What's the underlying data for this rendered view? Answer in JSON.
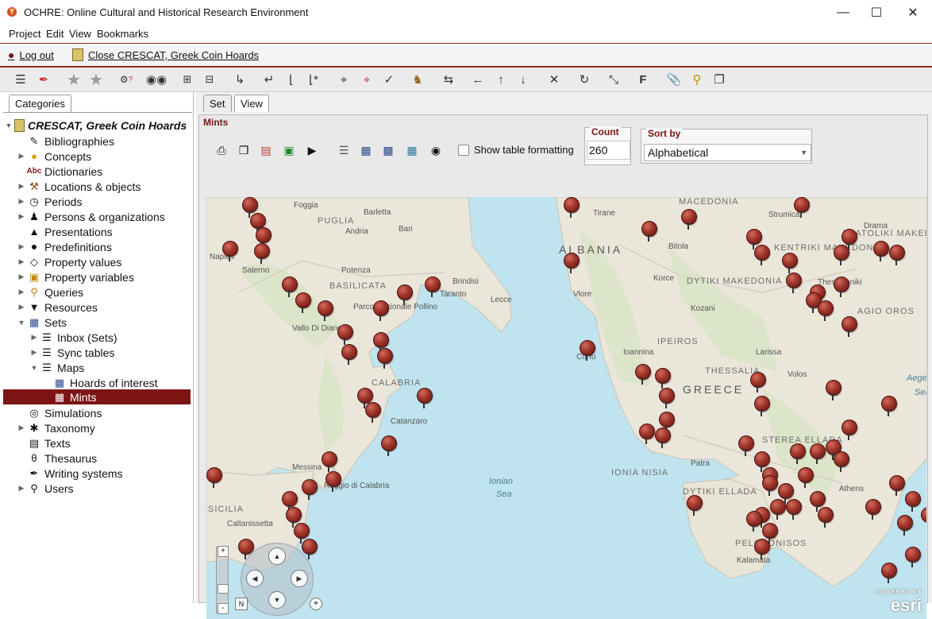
{
  "window": {
    "title": "OCHRE: Online Cultural and Historical Research Environment",
    "controls": [
      "minimize",
      "maximize",
      "close"
    ]
  },
  "menubar": {
    "items": [
      "Project",
      "Edit",
      "View",
      "Bookmarks"
    ]
  },
  "session": {
    "logout_label": "Log out",
    "close_label": "Close CRESCAT, Greek Coin Hoards"
  },
  "toolbar": {
    "icons": [
      "hierarchy-icon",
      "pen-icon",
      "star-icon",
      "star-icon",
      "help-lock-icon",
      "binoculars-icon",
      "expand-icon",
      "collapse-icon",
      "indent-icon",
      "outdent-icon",
      "move-first-icon",
      "move-star-icon",
      "crop-icon",
      "crop-red-icon",
      "check-crop-icon",
      "stamp-icon",
      "swap-icon",
      "arrow-left-icon",
      "arrow-up-icon",
      "arrow-down-icon",
      "close-icon",
      "refresh-icon",
      "resize-icon",
      "font-icon",
      "paperclip-icon",
      "search-icon",
      "windows-icon"
    ],
    "font_label": "F"
  },
  "sidebar": {
    "tab_label": "Categories",
    "root_label": "CRESCAT, Greek Coin Hoards",
    "items": [
      {
        "label": "Bibliographies",
        "icon": "bibliography-icon",
        "expandable": false
      },
      {
        "label": "Concepts",
        "icon": "lightbulb-icon",
        "expandable": true
      },
      {
        "label": "Dictionaries",
        "icon": "abc-icon",
        "icon_text": "Abc",
        "expandable": false
      },
      {
        "label": "Locations & objects",
        "icon": "tools-icon",
        "expandable": true
      },
      {
        "label": "Periods",
        "icon": "clock-icon",
        "expandable": true
      },
      {
        "label": "Persons & organizations",
        "icon": "person-icon",
        "expandable": true
      },
      {
        "label": "Presentations",
        "icon": "mortarboard-icon",
        "expandable": false
      },
      {
        "label": "Predefinitions",
        "icon": "pin-icon",
        "expandable": true
      },
      {
        "label": "Property values",
        "icon": "diamond-icon",
        "expandable": true
      },
      {
        "label": "Property variables",
        "icon": "tag-icon",
        "expandable": true
      },
      {
        "label": "Queries",
        "icon": "search-icon",
        "expandable": true
      },
      {
        "label": "Resources",
        "icon": "funnel-icon",
        "expandable": true
      },
      {
        "label": "Sets",
        "icon": "table-icon",
        "expandable": true,
        "expanded": true
      },
      {
        "label": "Inbox (Sets)",
        "icon": "tree-icon",
        "expandable": true,
        "level": 2
      },
      {
        "label": "Sync tables",
        "icon": "tree-icon",
        "expandable": true,
        "level": 2
      },
      {
        "label": "Maps",
        "icon": "tree-icon",
        "expandable": true,
        "expanded": true,
        "level": 2
      },
      {
        "label": "Hoards of interest",
        "icon": "table-icon",
        "expandable": false,
        "level": 3
      },
      {
        "label": "Mints",
        "icon": "table-icon",
        "expandable": false,
        "level": 3,
        "selected": true
      },
      {
        "label": "Simulations",
        "icon": "target-icon",
        "expandable": false
      },
      {
        "label": "Taxonomy",
        "icon": "asterisk-icon",
        "expandable": true
      },
      {
        "label": "Texts",
        "icon": "document-icon",
        "expandable": false
      },
      {
        "label": "Thesaurus",
        "icon": "theta-icon",
        "icon_text": "θ",
        "expandable": false
      },
      {
        "label": "Writing systems",
        "icon": "quill-icon",
        "expandable": false
      },
      {
        "label": "Users",
        "icon": "key-icon",
        "expandable": true
      }
    ]
  },
  "main": {
    "tabs": [
      "Set",
      "View"
    ],
    "active_tab": "View",
    "panel_title": "Mints",
    "panel_tools": [
      "print-icon",
      "copy-icon",
      "pdf-icon",
      "excel-icon",
      "export-icon",
      "list-icon",
      "table-icon",
      "form-icon",
      "image-icon",
      "globe-icon"
    ],
    "show_table_formatting_label": "Show table formatting",
    "show_table_formatting_checked": false,
    "count_label": "Count",
    "count_value": "260",
    "sortby_label": "Sort by",
    "sortby_value": "Alphabetical"
  },
  "map": {
    "countries": [
      "ALBANIA",
      "GREECE"
    ],
    "regions": [
      "MACEDONIA",
      "PUGLIA",
      "BASILICATA",
      "CALABRIA",
      "SICILIA",
      "IONIA NISIA",
      "THESSALIA",
      "IPEIROS",
      "DYTIKI MAKEDONIA",
      "KENTRIKI MAKEDONIA",
      "PELOPONISOS",
      "DYTIKI ELLADA",
      "STEREA ELLADA",
      "ANATOLIKI MAKEDONIA",
      "AGIO OROS"
    ],
    "cities": [
      "Foggia",
      "Barletta",
      "Bari",
      "Andria",
      "Potenza",
      "Salerno",
      "Brindisi",
      "Taranto",
      "Lecce",
      "Parco Nazionale Pollino",
      "Vallo Di Diano",
      "Catanzaro",
      "Messina",
      "Reggio di Calabria",
      "Caltanissetta",
      "Tirane",
      "Bitola",
      "Strumica",
      "Drama",
      "Korce",
      "Kozani",
      "Vlore",
      "Ioannina",
      "Larissa",
      "Volos",
      "Patra",
      "Kalamata",
      "Athens",
      "Corfu",
      "Thessaloniki",
      "Naples"
    ],
    "sea_labels": [
      "Ionian",
      "Sea",
      "Aegean",
      "Sea"
    ],
    "attribution": "esri",
    "attribution_small": "POWERED BY",
    "zoom_in": "+",
    "zoom_out": "-",
    "nav_center": "N",
    "pin_count_label": "260"
  }
}
